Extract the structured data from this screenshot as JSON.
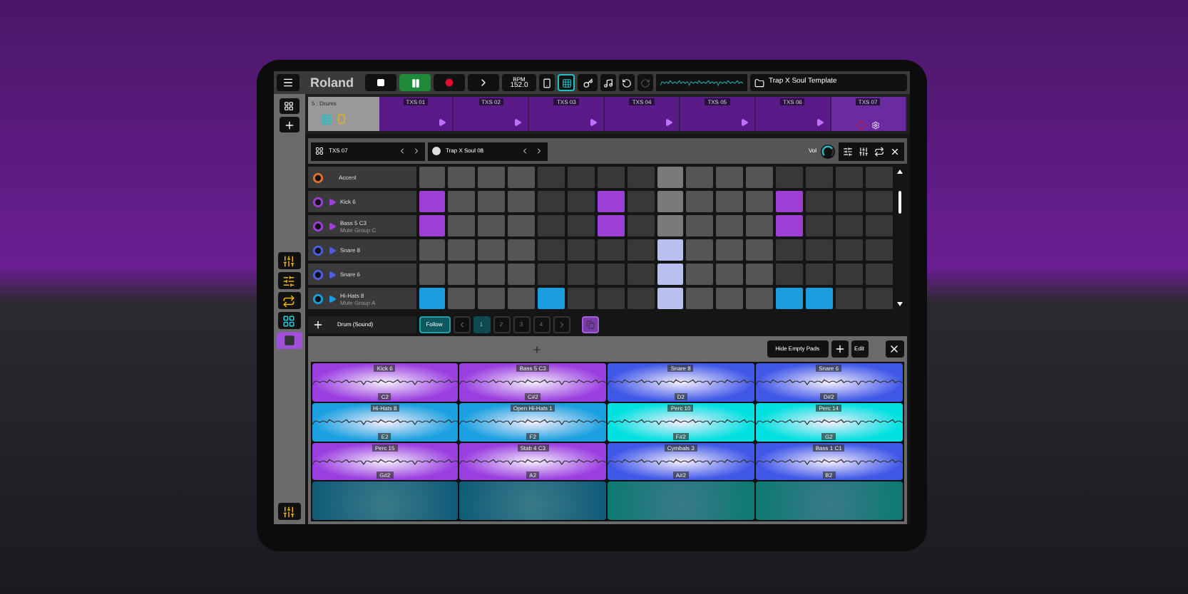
{
  "toolbar": {
    "logo": "Roland",
    "bpm_label": "BPM",
    "bpm": "152.0",
    "playing": true,
    "grid_view": true,
    "project": "Trap X Soul Template"
  },
  "track": {
    "name": "5 : Drums",
    "clips": [
      {
        "label": "TXS 01",
        "selected": false
      },
      {
        "label": "TXS 02",
        "selected": false
      },
      {
        "label": "TXS 03",
        "selected": false
      },
      {
        "label": "TXS 04",
        "selected": false
      },
      {
        "label": "TXS 05",
        "selected": false
      },
      {
        "label": "TXS 06",
        "selected": false
      },
      {
        "label": "TXS 07",
        "selected": true
      }
    ]
  },
  "sidebar": {
    "tools": [
      {
        "kind": "mixer",
        "selected": false
      },
      {
        "kind": "effects",
        "selected": false
      },
      {
        "kind": "loop",
        "selected": false
      },
      {
        "kind": "arranger",
        "selected": false
      },
      {
        "kind": "pads",
        "selected": true
      }
    ]
  },
  "pattern": {
    "clip": "TXS 07",
    "kit": "Trap X Soul 08",
    "vol_label": "Vol",
    "vol": {
      "level": 0.7
    },
    "columns": [
      {
        "current": false
      },
      {
        "current": false
      },
      {
        "current": false
      },
      {
        "current": false
      },
      {
        "current": false
      },
      {
        "current": false
      },
      {
        "current": false
      },
      {
        "current": false
      },
      {
        "current": true
      },
      {
        "current": false
      },
      {
        "current": false
      },
      {
        "current": false
      },
      {
        "current": false
      },
      {
        "current": false
      },
      {
        "current": false
      },
      {
        "current": false
      }
    ],
    "rows": [
      {
        "kind": "accent",
        "name": "Accent",
        "color": "#e0702a",
        "steps": [
          false,
          false,
          false,
          false,
          false,
          false,
          false,
          false,
          false,
          false,
          false,
          false,
          false,
          false,
          false,
          false
        ]
      },
      {
        "kind": "sound",
        "name": "Kick 6",
        "color": "#9b3fd6",
        "steps": [
          true,
          false,
          false,
          false,
          false,
          false,
          true,
          false,
          false,
          false,
          false,
          false,
          true,
          false,
          false,
          false
        ]
      },
      {
        "kind": "sound",
        "name": "Bass 5 C3",
        "sub": "Mute Group C",
        "color": "#9b3fd6",
        "steps": [
          true,
          false,
          false,
          false,
          false,
          false,
          true,
          false,
          false,
          false,
          false,
          false,
          true,
          false,
          false,
          false
        ]
      },
      {
        "kind": "sound",
        "name": "Snare 8",
        "color": "#4a5ee0",
        "steps": [
          false,
          false,
          false,
          false,
          false,
          false,
          false,
          false,
          true,
          false,
          false,
          false,
          false,
          false,
          false,
          false
        ]
      },
      {
        "kind": "sound",
        "name": "Snare 6",
        "color": "#4a5ee0",
        "steps": [
          false,
          false,
          false,
          false,
          false,
          false,
          false,
          false,
          true,
          false,
          false,
          false,
          false,
          false,
          false,
          false
        ]
      },
      {
        "kind": "sound",
        "name": "Hi-Hats 8",
        "sub": "Mute Group A",
        "color": "#1a9ee0",
        "steps": [
          true,
          false,
          false,
          false,
          true,
          false,
          false,
          false,
          true,
          false,
          false,
          false,
          true,
          true,
          false,
          false
        ]
      }
    ]
  },
  "controls": {
    "sound": "Drum (Sound)",
    "follow": "Follow",
    "pages": [
      {
        "label": "1",
        "selected": true
      },
      {
        "label": "2",
        "selected": false
      },
      {
        "label": "3",
        "selected": false
      },
      {
        "label": "4",
        "selected": false
      }
    ]
  },
  "pads_panel": {
    "hide_empty": "Hide Empty Pads",
    "edit": "Edit",
    "pads": [
      {
        "kind": "sample",
        "name": "Kick 6",
        "note": "C2",
        "color": "#9a3ee0"
      },
      {
        "kind": "sample",
        "name": "Bass 5 C3",
        "note": "C#2",
        "color": "#9a3ee0"
      },
      {
        "kind": "sample",
        "name": "Snare 8",
        "note": "D2",
        "color": "#4058e8"
      },
      {
        "kind": "sample",
        "name": "Snare 6",
        "note": "D#2",
        "color": "#4058e8"
      },
      {
        "kind": "sample",
        "name": "Hi-Hats 8",
        "note": "E2",
        "color": "#1aa0e0"
      },
      {
        "kind": "sample",
        "name": "Open Hi-Hats 1",
        "note": "F2",
        "color": "#1aa0e0"
      },
      {
        "kind": "sample",
        "name": "Perc 10",
        "note": "F#2",
        "color": "#00e0e0"
      },
      {
        "kind": "sample",
        "name": "Perc 14",
        "note": "G2",
        "color": "#00e0e0"
      },
      {
        "kind": "sample",
        "name": "Perc 15",
        "note": "G#2",
        "color": "#9a3ee0"
      },
      {
        "kind": "sample",
        "name": "Stab 4 C3",
        "note": "A2",
        "color": "#9a3ee0"
      },
      {
        "kind": "sample",
        "name": "Cymbals 3",
        "note": "A#2",
        "color": "#4058e8"
      },
      {
        "kind": "sample",
        "name": "Bass 1 C1",
        "note": "B2",
        "color": "#4058e8"
      },
      {
        "kind": "empty",
        "color": "#0e5a78"
      },
      {
        "kind": "empty",
        "color": "#0e5a78"
      },
      {
        "kind": "empty",
        "color": "#0a7a72"
      },
      {
        "kind": "empty",
        "color": "#0a7a72"
      }
    ]
  }
}
